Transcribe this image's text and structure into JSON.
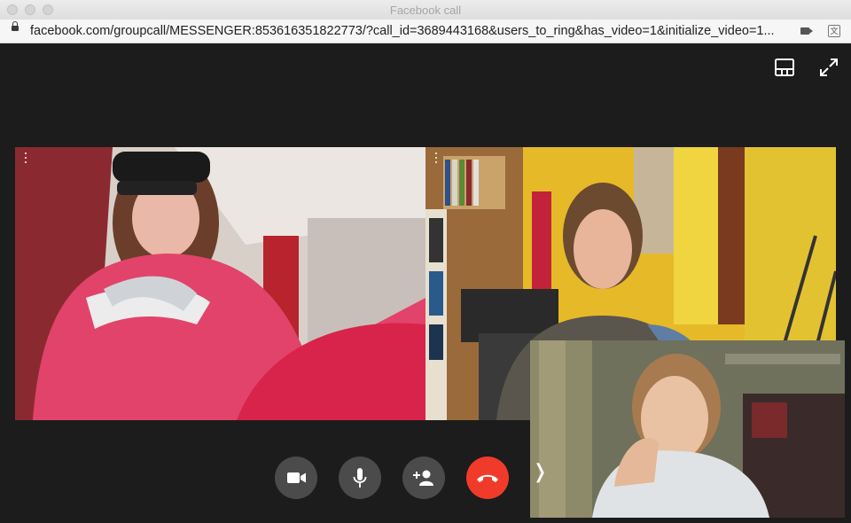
{
  "window": {
    "title": "Facebook call"
  },
  "address_bar": {
    "url": "facebook.com/groupcall/MESSENGER:853616351822773/?call_id=3689443168&users_to_ring&has_video=1&initialize_video=1..."
  },
  "top_actions": [
    {
      "name": "layout",
      "icon": "layout-icon"
    },
    {
      "name": "fullscreen",
      "icon": "expand-icon"
    }
  ],
  "participants": [
    {
      "name": "participant-left",
      "icon": "more-options-icon"
    },
    {
      "name": "participant-right",
      "icon": "more-options-icon"
    },
    {
      "name": "self-view"
    }
  ],
  "controls": [
    {
      "name": "video-toggle",
      "icon": "video-camera-icon"
    },
    {
      "name": "microphone-toggle",
      "icon": "microphone-icon"
    },
    {
      "name": "add-person",
      "icon": "add-person-icon"
    },
    {
      "name": "end-call",
      "icon": "hang-up-icon",
      "color": "#f03b2a"
    }
  ],
  "self_view_collapse": {
    "glyph": "❭",
    "icon": "chevron-right-icon"
  },
  "colors": {
    "call_background": "#1c1c1c",
    "control_button": "#4b4b4b",
    "end_call": "#f03b2a"
  }
}
